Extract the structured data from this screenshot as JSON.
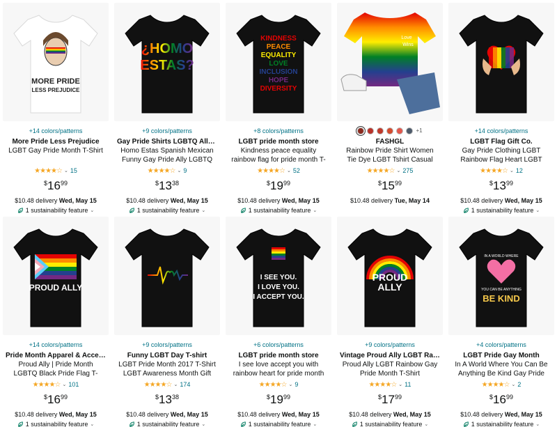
{
  "products": [
    {
      "colors": "+14 colors/patterns",
      "brand": "More Pride Less Prejudice",
      "title": "LGBT Gay Pride Month T-Shirt",
      "stars": "★★★★☆",
      "rating_value": 4.5,
      "review_count": "15",
      "price_currency": "$",
      "price_whole": "16",
      "price_fraction": "99",
      "delivery_prefix": "$10.48 delivery",
      "delivery_date": "Wed, May 15",
      "sustainability": "1 sustainability feature",
      "shirt_color": "#ffffff",
      "design": "portrait",
      "print_lines": [
        "MORE PRIDE",
        "LESS PREJUDICE"
      ]
    },
    {
      "colors": "+9 colors/patterns",
      "brand": "Gay Pride Shirts LGBTQ Ally LGBT...",
      "title": "Homo Estas Spanish Mexican Funny Gay Pride Ally LGBTQ Month T-Shirt",
      "stars": "★★★★☆",
      "rating_value": 4.5,
      "review_count": "9",
      "price_currency": "$",
      "price_whole": "13",
      "price_fraction": "38",
      "delivery_prefix": "$10.48 delivery",
      "delivery_date": "Wed, May 15",
      "sustainability": "1 sustainability feature",
      "shirt_color": "#111111",
      "design": "homo",
      "print_lines": [
        "¿HOMO",
        "ESTAS?"
      ]
    },
    {
      "colors": "+8 colors/patterns",
      "brand": "LGBT pride month store",
      "title": "Kindness peace equality rainbow flag for pride month T-Shirt",
      "stars": "★★★★☆",
      "rating_value": 4.5,
      "review_count": "52",
      "price_currency": "$",
      "price_whole": "19",
      "price_fraction": "99",
      "delivery_prefix": "$10.48 delivery",
      "delivery_date": "Wed, May 15",
      "sustainability": "1 sustainability feature",
      "shirt_color": "#111111",
      "design": "words",
      "print_lines": [
        "KINDNESS",
        "PEACE",
        "EQUALITY",
        "LOVE",
        "INCLUSION",
        "HOPE",
        "DIVERSITY"
      ]
    },
    {
      "colors": "",
      "swatches": [
        "#8b2a1e",
        "#b8322a",
        "#c0392b",
        "#d44b2f",
        "#e2574c",
        "#4d5a6a"
      ],
      "swatch_more": "+1",
      "brand": "FASHGL",
      "title": "Rainbow Pride Shirt Women Tie Dye LGBT Tshirt Casual Gay Lesbian Pride...",
      "stars": "★★★★☆",
      "rating_value": 4.0,
      "review_count": "275",
      "price_currency": "$",
      "price_whole": "15",
      "price_fraction": "99",
      "delivery_prefix": "$10.48 delivery",
      "delivery_date": "Tue, May 14",
      "sustainability": "",
      "shirt_color": "#ffffff",
      "design": "tiedye",
      "print_lines": [
        "Love",
        "Wins"
      ]
    },
    {
      "colors": "+14 colors/patterns",
      "brand": "LGBT Flag Gift Co.",
      "title": "Gay Pride Clothing LGBT Rainbow Flag Heart LGBT Pride Month T-Shirt",
      "stars": "★★★★☆",
      "rating_value": 4.5,
      "review_count": "12",
      "price_currency": "$",
      "price_whole": "13",
      "price_fraction": "99",
      "delivery_prefix": "$10.48 delivery",
      "delivery_date": "Wed, May 15",
      "sustainability": "1 sustainability feature",
      "shirt_color": "#111111",
      "design": "hands",
      "print_lines": []
    },
    {
      "colors": "+14 colors/patterns",
      "brand": "Pride Month Apparel & Accessories",
      "title": "Proud Ally | Pride Month LGBTQ Black Pride Flag T-Shirt",
      "stars": "★★★★☆",
      "rating_value": 4.5,
      "review_count": "101",
      "price_currency": "$",
      "price_whole": "16",
      "price_fraction": "99",
      "delivery_prefix": "$10.48 delivery",
      "delivery_date": "Wed, May 15",
      "sustainability": "1 sustainability feature",
      "shirt_color": "#111111",
      "design": "flag",
      "print_lines": [
        "PROUD ALLY"
      ]
    },
    {
      "colors": "+9 colors/patterns",
      "brand": "Funny LGBT Day T-shirt",
      "title": "LGBT Pride Month 2017 T-Shirt LGBT Awareness Month Gift Tee T-Shirt",
      "stars": "★★★★☆",
      "rating_value": 4.5,
      "review_count": "174",
      "price_currency": "$",
      "price_whole": "13",
      "price_fraction": "38",
      "delivery_prefix": "$10.48 delivery",
      "delivery_date": "Wed, May 15",
      "sustainability": "1 sustainability feature",
      "shirt_color": "#111111",
      "design": "heartbeat",
      "print_lines": []
    },
    {
      "colors": "+6 colors/patterns",
      "brand": "LGBT pride month store",
      "title": "I see love accept you with rainbow heart for pride month T-Shirt",
      "stars": "★★★★☆",
      "rating_value": 4.5,
      "review_count": "9",
      "price_currency": "$",
      "price_whole": "19",
      "price_fraction": "99",
      "delivery_prefix": "$10.48 delivery",
      "delivery_date": "Wed, May 15",
      "sustainability": "1 sustainability feature",
      "shirt_color": "#111111",
      "design": "iseeyou",
      "print_lines": [
        "I SEE YOU.",
        "I LOVE YOU.",
        "I ACCEPT YOU."
      ]
    },
    {
      "colors": "+9 colors/patterns",
      "brand": "Vintage Proud Ally LGBT Rainbow...",
      "title": "Proud Ally LGBT Rainbow Gay Pride Month T-Shirt",
      "stars": "★★★★☆",
      "rating_value": 4.5,
      "review_count": "11",
      "price_currency": "$",
      "price_whole": "17",
      "price_fraction": "99",
      "delivery_prefix": "$10.48 delivery",
      "delivery_date": "Wed, May 15",
      "sustainability": "1 sustainability feature",
      "shirt_color": "#111111",
      "design": "rainbow",
      "print_lines": [
        "PROUD",
        "ALLY"
      ]
    },
    {
      "colors": "+4 colors/patterns",
      "brand": "LGBT Pride Gay Month",
      "title": "In A World Where You Can Be Anything Be Kind Gay Pride LGBT T-...",
      "stars": "★★★★☆",
      "rating_value": 4.5,
      "review_count": "2",
      "price_currency": "$",
      "price_whole": "16",
      "price_fraction": "99",
      "delivery_prefix": "$10.48 delivery",
      "delivery_date": "Wed, May 15",
      "sustainability": "1 sustainability feature",
      "shirt_color": "#111111",
      "design": "bekind",
      "print_lines": [
        "IN A WORLD WHERE",
        "YOU CAN BE ANYTHING",
        "BE KIND"
      ]
    }
  ],
  "colors": {
    "link": "#007185",
    "star": "#f5a623",
    "leaf": "#067D62",
    "rainbow": [
      "#e40303",
      "#ff8c00",
      "#ffed00",
      "#008026",
      "#24408e",
      "#732982"
    ]
  }
}
